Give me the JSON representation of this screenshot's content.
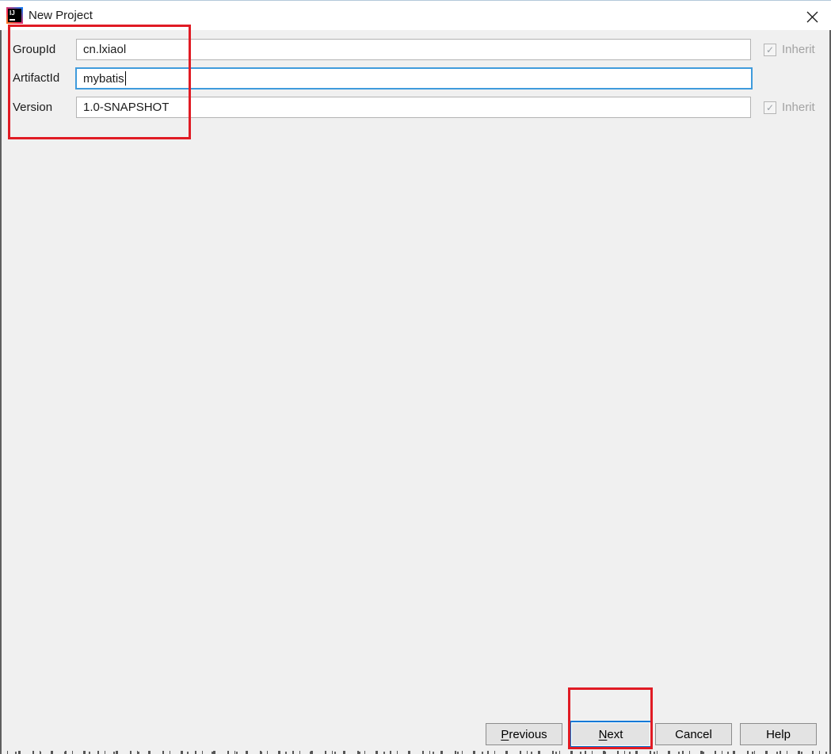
{
  "colors": {
    "annotation_red": "#e01b24",
    "focus_blue": "#0078d7",
    "input_focus_border": "#3f9bdc",
    "titlebar_bg": "#ffffff",
    "body_bg": "#f0f0f0"
  },
  "window": {
    "title": "New Project"
  },
  "app_icon": {
    "text": "IJ"
  },
  "form": {
    "inherit_label": "Inherit",
    "check_glyph": "✓",
    "fields": [
      {
        "label": "GroupId",
        "value": "cn.lxiaol"
      },
      {
        "label": "ArtifactId",
        "value": "mybatis"
      },
      {
        "label": "Version",
        "value": "1.0-SNAPSHOT"
      }
    ]
  },
  "buttons": {
    "previous": {
      "mnemonic": "P",
      "rest": "revious"
    },
    "next": {
      "mnemonic": "N",
      "rest": "ext"
    },
    "cancel": {
      "label": "Cancel"
    },
    "help": {
      "label": "Help"
    }
  }
}
